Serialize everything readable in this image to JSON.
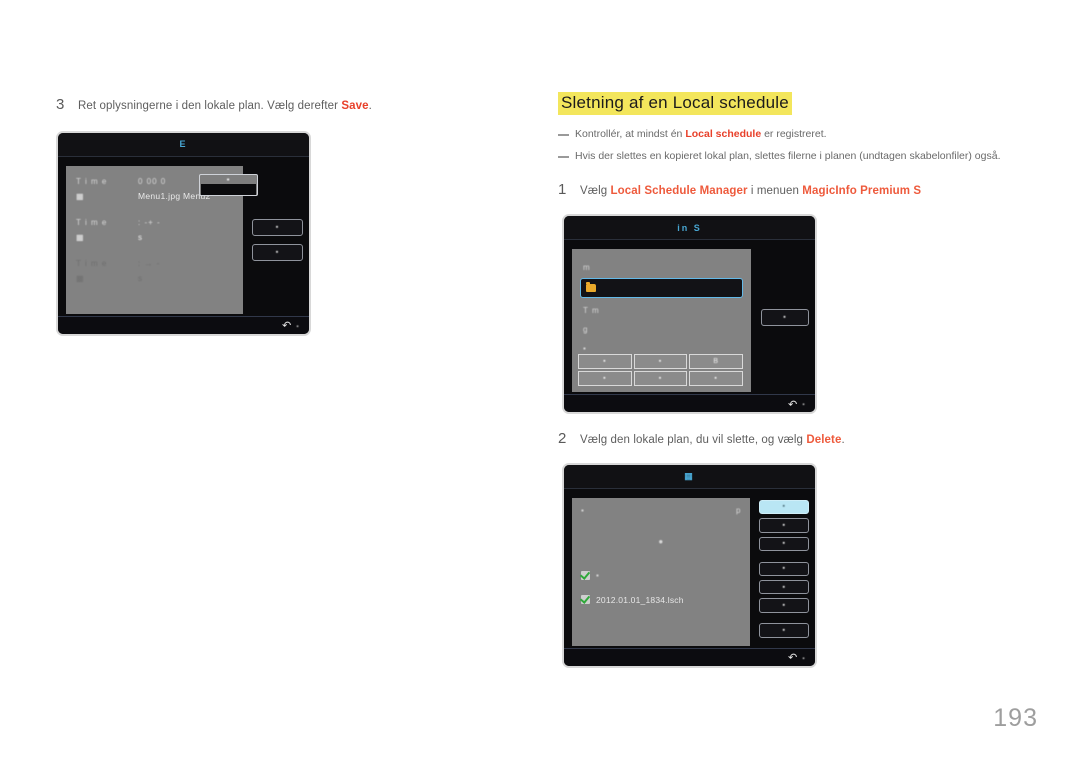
{
  "page": {
    "number": "193"
  },
  "left": {
    "step": {
      "num": "3",
      "text_before": "Ret oplysningerne i den lokale plan. Vælg derefter ",
      "highlight": "Save",
      "text_after": "."
    },
    "panel": {
      "title": "E",
      "rows": [
        {
          "label": "T  i m  e",
          "value": "0  00  0"
        },
        {
          "label": "",
          "value": "Menu1.jpg Menu2"
        },
        {
          "label": "T  i m  e",
          "value": ":  -+  -"
        },
        {
          "label": "",
          "value": "s"
        },
        {
          "label": "T i m e",
          "value": ":  →  -"
        },
        {
          "label": "",
          "value": "s"
        }
      ],
      "popup_label": "",
      "side_buttons": [
        "",
        ""
      ],
      "footer_label": ""
    }
  },
  "right": {
    "section_title": "Sletning af en Local schedule",
    "notes": [
      {
        "before": "Kontrollér, at mindst én ",
        "highlight": "Local schedule",
        "after": " er registreret."
      },
      {
        "before": "Hvis der slettes en kopieret lokal plan, slettes filerne i planen (undtagen skabelonfiler) også.",
        "highlight": "",
        "after": ""
      }
    ],
    "step1": {
      "num": "1",
      "t1": "Vælg ",
      "h1": "Local Schedule Manager",
      "t2": " i menuen ",
      "h2": "MagicInfo Premium S"
    },
    "step2": {
      "num": "2",
      "t1": "Vælg den lokale plan, du vil slette, og vælg ",
      "h1": "Delete",
      "t2": "."
    },
    "panel2": {
      "title": "in S",
      "header_row": "m",
      "selected_row_label": "",
      "rows": [
        "T m",
        "g",
        ""
      ],
      "grid_buttons": [
        "",
        "",
        "B",
        "",
        "",
        ""
      ],
      "side_button": "",
      "footer_label": ""
    },
    "panel3": {
      "title": "",
      "head_left": "",
      "head_right": "p",
      "center_marker": "",
      "items": [
        {
          "checked": true,
          "name": ""
        },
        {
          "checked": true,
          "name": "2012.01.01_1834.lsch"
        }
      ],
      "side_buttons": [
        "",
        "",
        "",
        "",
        "",
        "",
        ""
      ],
      "footer_label": ""
    }
  }
}
